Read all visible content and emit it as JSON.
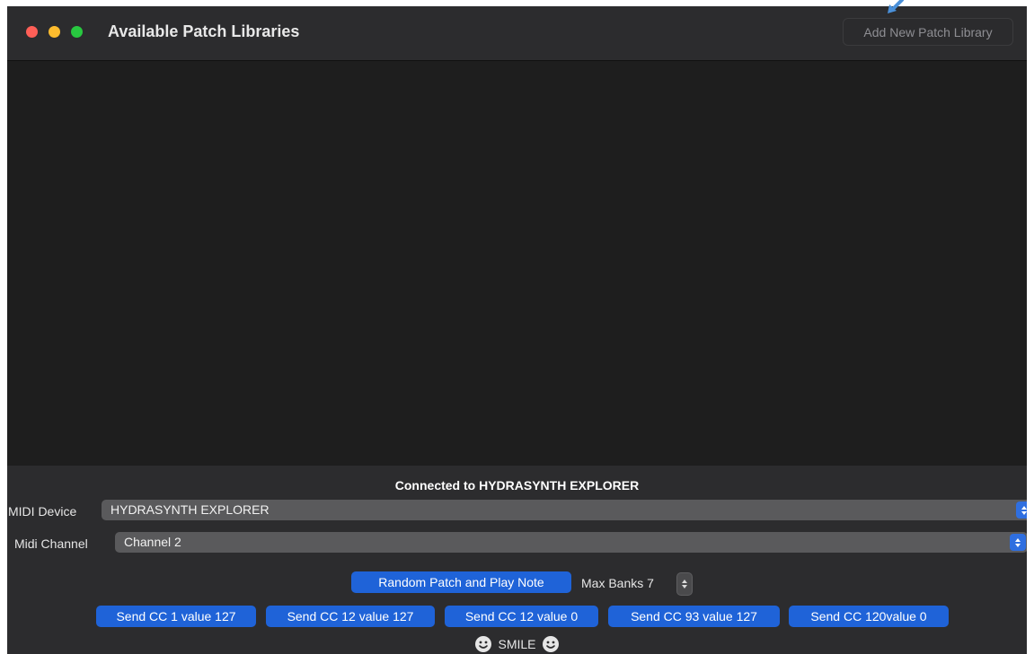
{
  "window": {
    "title": "Available Patch Libraries",
    "add_button_label": "Add New Patch Library"
  },
  "status": {
    "connected_text": "Connected to HYDRASYNTH EXPLORER"
  },
  "midi_device": {
    "label": "MIDI Device",
    "value": "HYDRASYNTH EXPLORER"
  },
  "midi_channel": {
    "label": "Midi Channel",
    "value": "Channel 2"
  },
  "random": {
    "button_label": "Random Patch and Play Note",
    "max_banks_label": "Max Banks 7"
  },
  "cc_buttons": [
    {
      "label": "Send CC 1 value 127"
    },
    {
      "label": "Send CC 12 value 127"
    },
    {
      "label": "Send CC 12 value 0"
    },
    {
      "label": "Send CC 93 value 127"
    },
    {
      "label": "Send CC 120value 0"
    }
  ],
  "smile": {
    "label": "SMILE"
  },
  "icons": {
    "close": "close-traffic-light-icon",
    "minimize": "minimize-traffic-light-icon",
    "maximize": "maximize-traffic-light-icon",
    "dropdown": "chevron-up-down-icon",
    "smiley": "smiley-face-icon",
    "pointer": "annotation-arrow-icon"
  },
  "colors": {
    "accent": "#1f63d8",
    "window_bg": "#1e1e1e",
    "panel_bg": "#2c2c2e",
    "close": "#ff5f57",
    "minimize": "#febc2e",
    "maximize": "#28c840",
    "annotation": "#4a90d9"
  }
}
